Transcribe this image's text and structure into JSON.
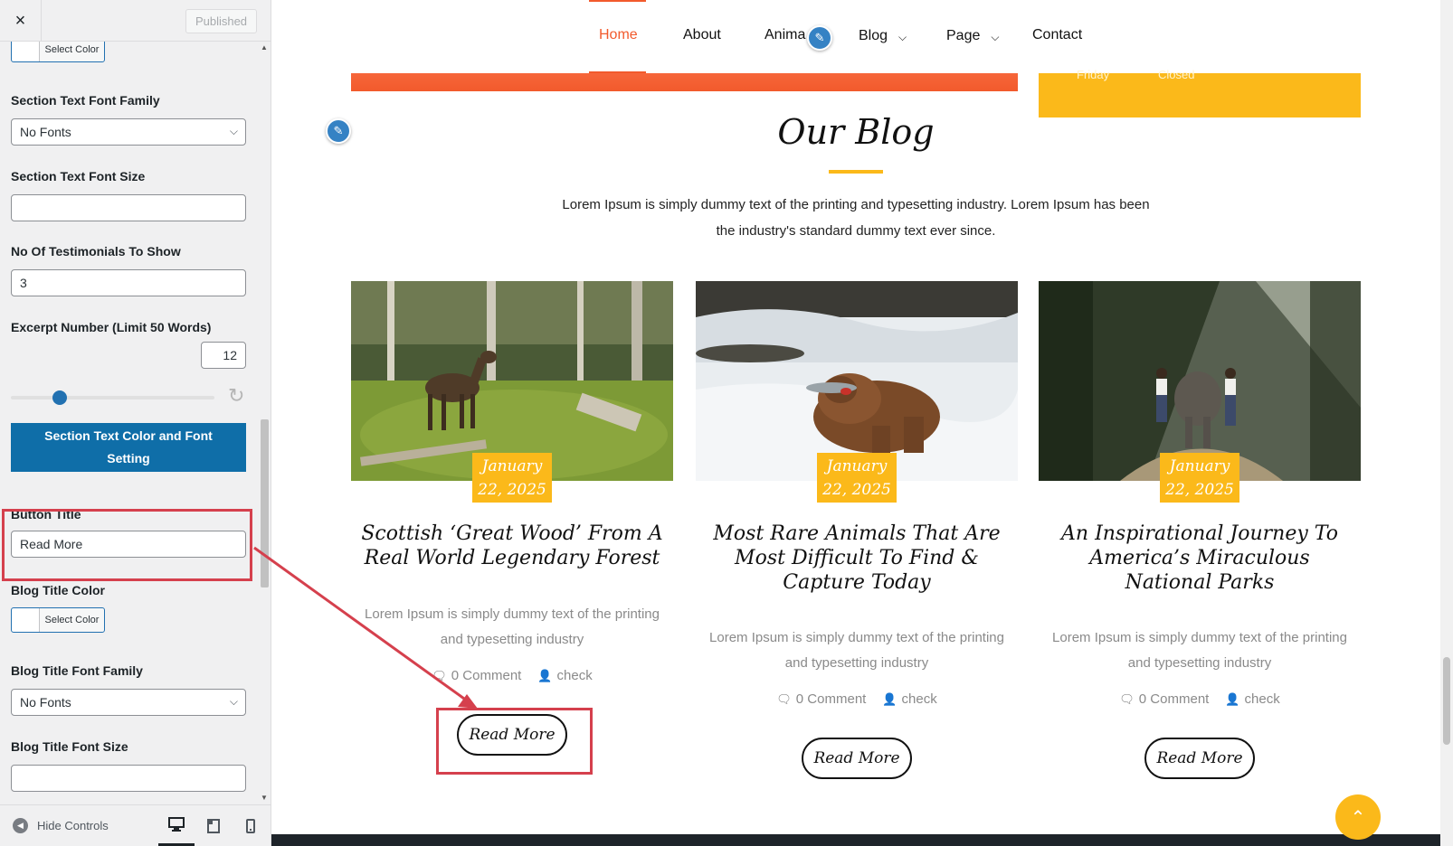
{
  "sidebar": {
    "published_label": "Published",
    "close_icon": "×",
    "controls": {
      "section_text_color_select": "Select Color",
      "section_text_font_family_label": "Section Text Font Family",
      "section_text_font_family_value": "No Fonts",
      "section_text_font_size_label": "Section Text Font Size",
      "section_text_font_size_value": "",
      "testimonials_label": "No Of Testimonials To Show",
      "testimonials_value": "3",
      "excerpt_label": "Excerpt Number (Limit 50 Words)",
      "excerpt_value": "12",
      "excerpt_slider_fraction": 0.24,
      "section_btn_label": "Section Text Color and Font Setting",
      "button_title_label": "Button Title",
      "button_title_value": "Read More",
      "blog_title_color_label": "Blog Title Color",
      "blog_title_color_select": "Select Color",
      "blog_title_font_family_label": "Blog Title Font Family",
      "blog_title_font_family_value": "No Fonts",
      "blog_title_font_size_label": "Blog Title Font Size",
      "blog_title_font_size_value": ""
    },
    "footer": {
      "hide_controls_label": "Hide Controls"
    }
  },
  "preview": {
    "nav": {
      "items": [
        "Home",
        "About",
        "Anima",
        "Blog",
        "Page",
        "Contact"
      ]
    },
    "yellow_box_text": [
      "Friday",
      "Closed"
    ],
    "blog_section": {
      "title": "Our Blog",
      "intro_line1": "Lorem Ipsum is simply dummy text of the printing and typesetting industry. Lorem Ipsum has been",
      "intro_line2": "the industry's standard dummy text ever since."
    },
    "cards": [
      {
        "date_line1": "January",
        "date_line2": "22, 2025",
        "title": "Scottish ‘Great Wood’ From A Real World Legendary Forest",
        "excerpt_line1": "Lorem Ipsum is simply dummy text of the printing",
        "excerpt_line2": "and typesetting industry",
        "comments": "0 Comment",
        "author": "check",
        "read_more": "Read More"
      },
      {
        "date_line1": "January",
        "date_line2": "22, 2025",
        "title": "Most Rare Animals That Are Most Difficult To Find & Capture Today",
        "excerpt_line1": "Lorem Ipsum is simply dummy text of the printing",
        "excerpt_line2": "and typesetting industry",
        "comments": "0 Comment",
        "author": "check",
        "read_more": "Read More"
      },
      {
        "date_line1": "January",
        "date_line2": "22, 2025",
        "title": "An Inspirational Journey To America’s Miraculous National Parks",
        "excerpt_line1": "Lorem Ipsum is simply dummy text of the printing",
        "excerpt_line2": "and typesetting industry",
        "comments": "0 Comment",
        "author": "check",
        "read_more": "Read More"
      }
    ]
  },
  "colors": {
    "accent_orange": "#f25a2c",
    "accent_yellow": "#fbb91a",
    "wp_blue": "#2271b1",
    "annotation_red": "#d5404d"
  }
}
